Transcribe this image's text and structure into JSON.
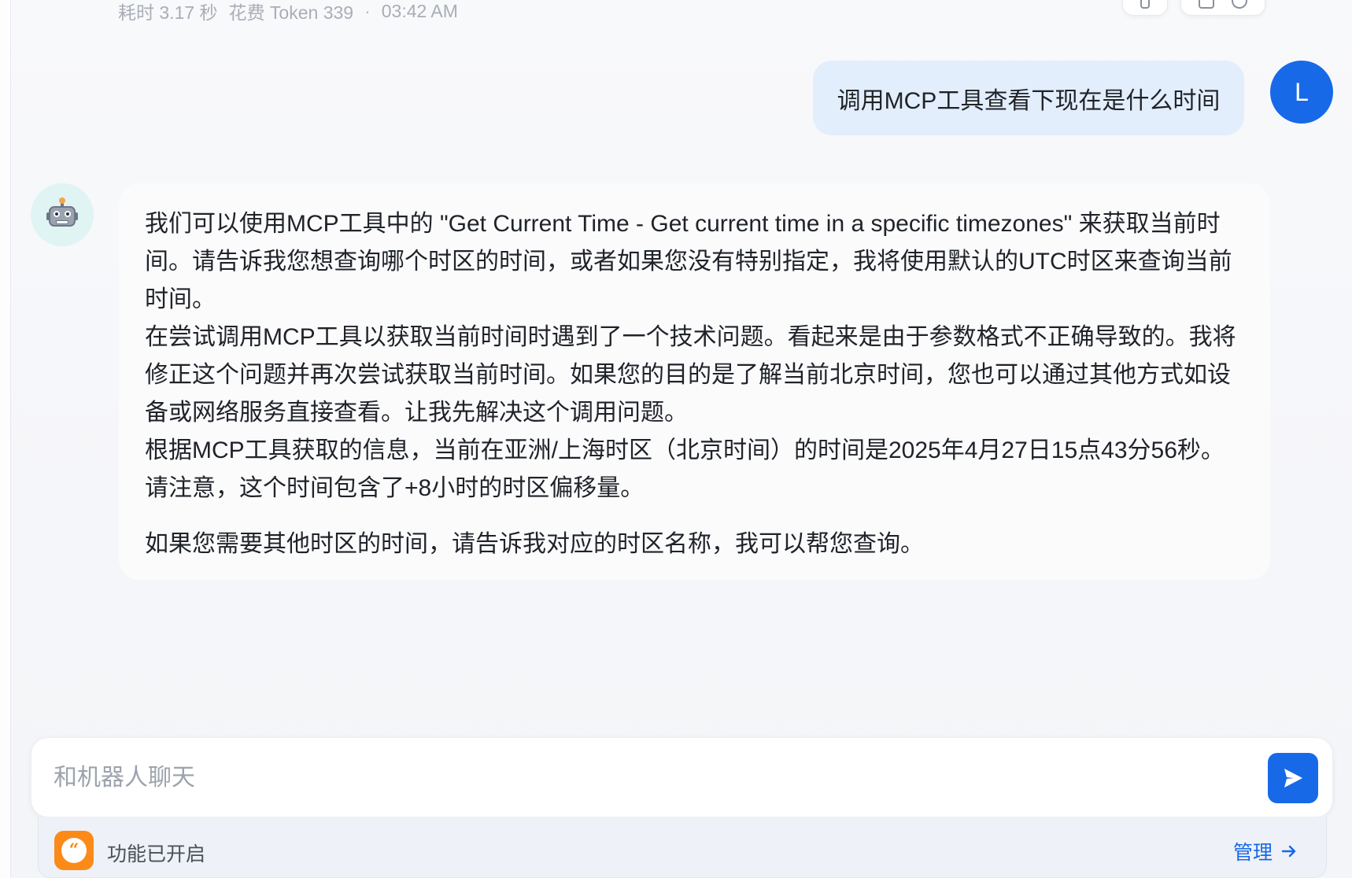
{
  "meta": {
    "duration": "耗时 3.17 秒",
    "tokens": "花费 Token 339",
    "separator": "·",
    "time": "03:42 AM"
  },
  "user_message": {
    "text": "调用MCP工具查看下现在是什么时间",
    "avatar_letter": "L",
    "avatar_color": "#1769e8"
  },
  "bot_message": {
    "paragraphs": [
      "我们可以使用MCP工具中的 \"Get Current Time - Get current time in a specific timezones\" 来获取当前时间。请告诉我您想查询哪个时区的时间，或者如果您没有特别指定，我将使用默认的UTC时区来查询当前时间。",
      "在尝试调用MCP工具以获取当前时间时遇到了一个技术问题。看起来是由于参数格式不正确导致的。我将修正这个问题并再次尝试获取当前时间。如果您的目的是了解当前北京时间，您也可以通过其他方式如设备或网络服务直接查看。让我先解决这个调用问题。",
      "根据MCP工具获取的信息，当前在亚洲/上海时区（北京时间）的时间是2025年4月27日15点43分56秒。请注意，这个时间包含了+8小时的时区偏移量。",
      "如果您需要其他时区的时间，请告诉我对应的时区名称，我可以帮您查询。"
    ],
    "avatar_icon": "robot-icon",
    "avatar_bg": "#dff4f3"
  },
  "input": {
    "placeholder": "和机器人聊天",
    "value": ""
  },
  "send_button": {
    "icon": "send-icon",
    "color": "#1769e8"
  },
  "feature_bar": {
    "icon": "quote-bubble-icon",
    "icon_color": "#fb8a19",
    "status_text": "功能已开启",
    "manage_label": "管理",
    "manage_icon": "arrow-right-icon"
  }
}
